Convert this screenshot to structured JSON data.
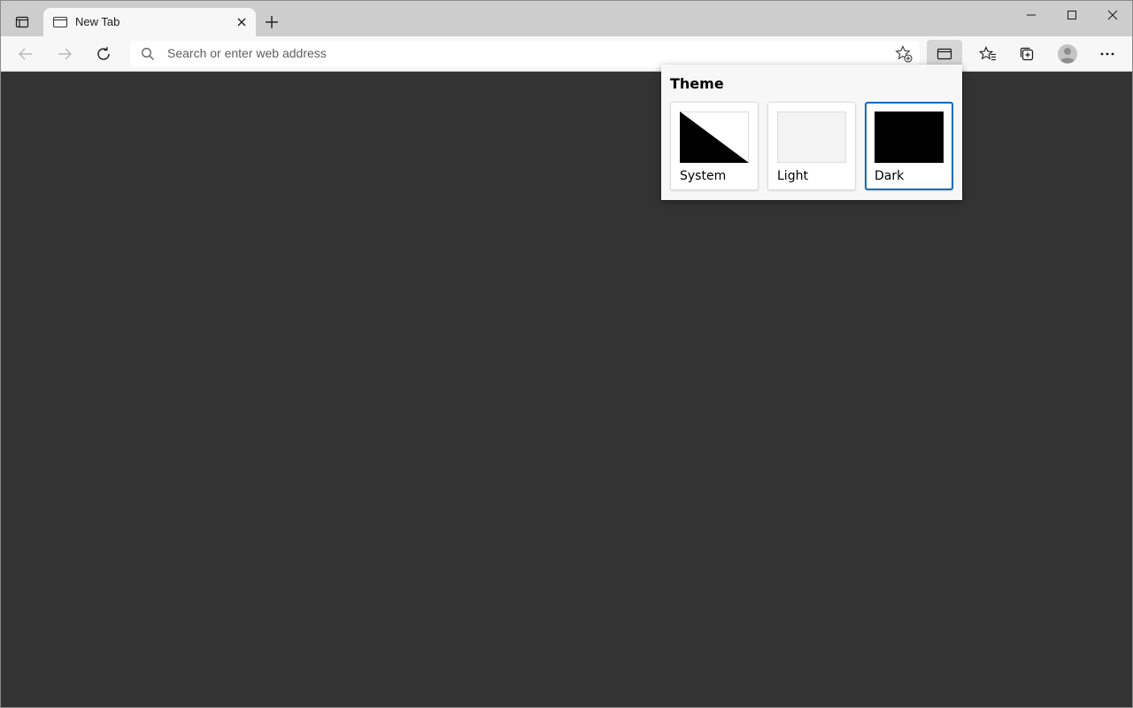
{
  "tab": {
    "title": "New Tab"
  },
  "addressbar": {
    "placeholder": "Search or enter web address"
  },
  "theme_popup": {
    "heading": "Theme",
    "options": [
      {
        "label": "System",
        "selected": false
      },
      {
        "label": "Light",
        "selected": false
      },
      {
        "label": "Dark",
        "selected": true
      }
    ]
  },
  "colors": {
    "page_background": "#333333",
    "selected_border": "#0f6cbd",
    "titlebar": "#cdcdcd",
    "toolbar": "#f7f7f7"
  },
  "icons": {
    "tab_actions": "tab-actions-icon",
    "favicon": "page-icon",
    "close_tab": "close-icon",
    "new_tab": "plus-icon",
    "minimize": "minimize-icon",
    "maximize": "maximize-icon",
    "close_window": "close-icon",
    "back": "arrow-left-icon",
    "forward": "arrow-right-icon",
    "refresh": "refresh-icon",
    "search": "search-icon",
    "add_favorite": "star-add-icon",
    "immersive_reader": "reader-view-icon",
    "favorites": "favorites-icon",
    "collections": "collections-icon",
    "profile": "profile-icon",
    "menu": "more-icon"
  }
}
